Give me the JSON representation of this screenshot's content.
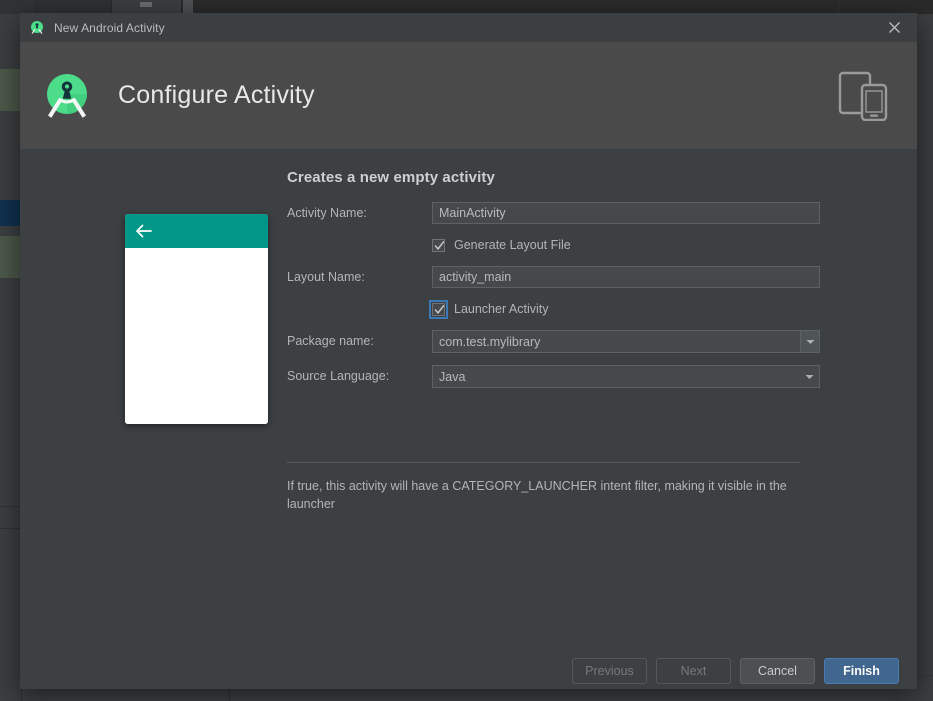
{
  "window": {
    "titlebar_title": "New Android Activity",
    "titlebar_icon": "android-studio-icon",
    "close_icon": "close-icon"
  },
  "header": {
    "wizard_title": "Configure Activity",
    "logo_icon": "android-studio-logo-icon",
    "device_icon": "tablet-and-phone-icon"
  },
  "preview": {
    "appbar_color": "#009688",
    "back_icon": "back-arrow-icon",
    "body_color": "#ffffff"
  },
  "form": {
    "heading": "Creates a new empty activity",
    "fields": [
      {
        "label": "Activity Name:",
        "value": "MainActivity",
        "placeholder": "MainActivity",
        "type": "text",
        "name": "activity-name"
      },
      {
        "label": "Layout Name:",
        "value": "activity_main",
        "placeholder": "activity_main",
        "type": "text",
        "name": "layout-name"
      },
      {
        "label": "Package name:",
        "value": "com.test.mylibrary",
        "type": "editable-combo",
        "name": "package-name"
      },
      {
        "label": "Source Language:",
        "value": "Java",
        "type": "combo",
        "name": "source-language"
      }
    ],
    "checkboxes": [
      {
        "label": "Generate Layout File",
        "checked": true,
        "focused": false,
        "name": "generate-layout-file"
      },
      {
        "label": "Launcher Activity",
        "checked": true,
        "focused": true,
        "name": "launcher-activity"
      }
    ]
  },
  "help": {
    "text": "If true, this activity will have a CATEGORY_LAUNCHER intent filter, making it visible in the launcher"
  },
  "footer": {
    "previous_label": "Previous",
    "next_label": "Next",
    "cancel_label": "Cancel",
    "finish_label": "Finish",
    "finish_color": "#41668f"
  }
}
